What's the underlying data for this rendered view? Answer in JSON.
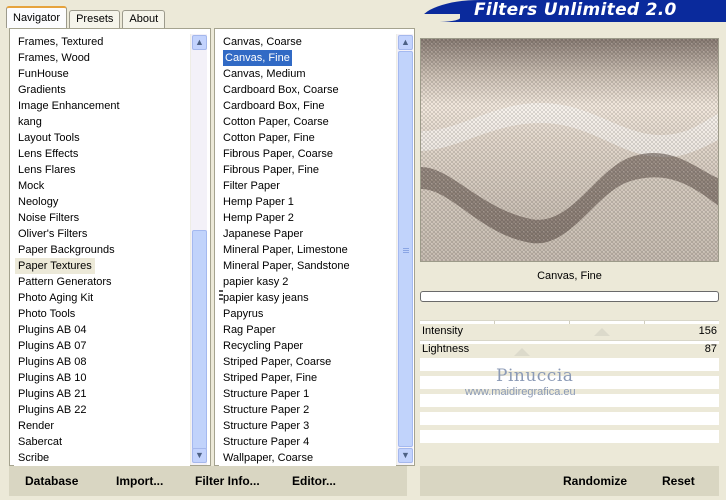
{
  "app": {
    "title": "Filters Unlimited 2.0"
  },
  "tabs": [
    {
      "label": "Navigator",
      "active": true
    },
    {
      "label": "Presets",
      "active": false
    },
    {
      "label": "About",
      "active": false
    }
  ],
  "categories": {
    "items": [
      "Frames, Textured",
      "Frames, Wood",
      "FunHouse",
      "Gradients",
      "Image Enhancement",
      "kang",
      "Layout Tools",
      "Lens Effects",
      "Lens Flares",
      "Mock",
      "Neology",
      "Noise Filters",
      "Oliver's Filters",
      "Paper Backgrounds",
      "Paper Textures",
      "Pattern Generators",
      "Photo Aging Kit",
      "Photo Tools",
      "Plugins AB 04",
      "Plugins AB 07",
      "Plugins AB 08",
      "Plugins AB 10",
      "Plugins AB 21",
      "Plugins AB 22",
      "Render",
      "Sabercat",
      "Scribe"
    ],
    "selected": "Paper Textures"
  },
  "filters": {
    "items": [
      "Canvas, Coarse",
      "Canvas, Fine",
      "Canvas, Medium",
      "Cardboard Box, Coarse",
      "Cardboard Box, Fine",
      "Cotton Paper, Coarse",
      "Cotton Paper, Fine",
      "Fibrous Paper, Coarse",
      "Fibrous Paper, Fine",
      "Filter Paper",
      "Hemp Paper 1",
      "Hemp Paper 2",
      "Japanese Paper",
      "Mineral Paper, Limestone",
      "Mineral Paper, Sandstone",
      "papier kasy 2",
      "papier kasy jeans",
      "Papyrus",
      "Rag Paper",
      "Recycling Paper",
      "Striped Paper, Coarse",
      "Striped Paper, Fine",
      "Structure Paper 1",
      "Structure Paper 2",
      "Structure Paper 3",
      "Structure Paper 4",
      "Wallpaper, Coarse"
    ],
    "selected": "Canvas, Fine"
  },
  "preview": {
    "filter_name": "Canvas, Fine",
    "progress": 0
  },
  "params": [
    {
      "label": "Intensity",
      "value": "156"
    },
    {
      "label": "Lightness",
      "value": "87"
    }
  ],
  "watermark": {
    "name": "Pinuccia",
    "url": "www.maidiregrafica.eu"
  },
  "buttons": {
    "database": "Database",
    "import": "Import...",
    "filter_info": "Filter Info...",
    "editor": "Editor...",
    "randomize": "Randomize",
    "reset": "Reset"
  },
  "colors": {
    "window_bg": "#ece9d8",
    "header_blue": "#0a2a9c",
    "selection": "#316ac5",
    "scrollbar": "#c1d3fb"
  },
  "icons": [
    "chevron-up-icon",
    "chevron-down-icon",
    "scroll-grip-icon"
  ]
}
